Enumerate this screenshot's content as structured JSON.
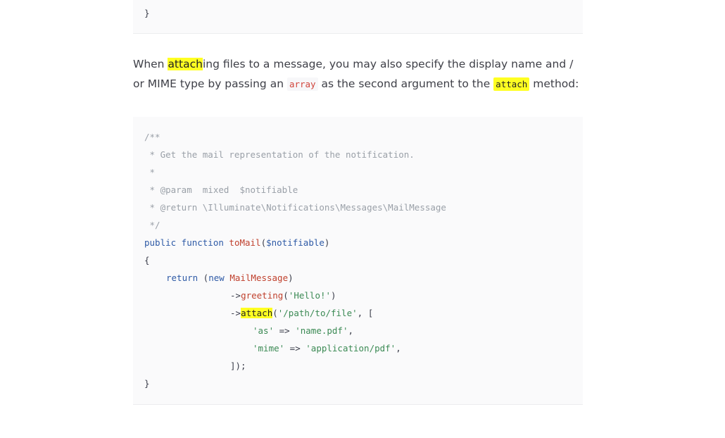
{
  "prev_block": {
    "closing_brace": "}"
  },
  "paragraph": {
    "line1_pre": "When ",
    "line1_hl": "attach",
    "line1_post": "ing files to a message, you may also specify the display name and /",
    "line2_pre": "or MIME type by passing an ",
    "line2_code": "array",
    "line2_mid": " as the second argument to the ",
    "line2_code2": "attach",
    "line2_post": " method:"
  },
  "code": {
    "c1": "/**",
    "c2": " * Get the mail representation of the notification.",
    "c3": " *",
    "c4": " * @param  mixed  $notifiable",
    "c5": " * @return \\Illuminate\\Notifications\\Messages\\MailMessage",
    "c6": " */",
    "sig_kw": "public function ",
    "sig_fn": "toMail",
    "sig_open": "(",
    "sig_var": "$notifiable",
    "sig_close": ")",
    "open_brace": "{",
    "ret_kw": "return",
    "ret_mid": " (",
    "ret_new": "new",
    "ret_sp": " ",
    "ret_cls": "MailMessage",
    "ret_close": ")",
    "g_arrow": "->",
    "g_fn": "greeting",
    "g_open": "(",
    "g_str": "'Hello!'",
    "g_close": ")",
    "a_arrow": "->",
    "a_fn": "attach",
    "a_open": "(",
    "a_str": "'/path/to/file'",
    "a_rest": ", [",
    "as_key": "'as'",
    "as_op": " => ",
    "as_val": "'name.pdf'",
    "as_comma": ",",
    "mime_key": "'mime'",
    "mime_op": " => ",
    "mime_val": "'application/pdf'",
    "mime_comma": ",",
    "end_arr": "]);",
    "close_brace": "}"
  }
}
